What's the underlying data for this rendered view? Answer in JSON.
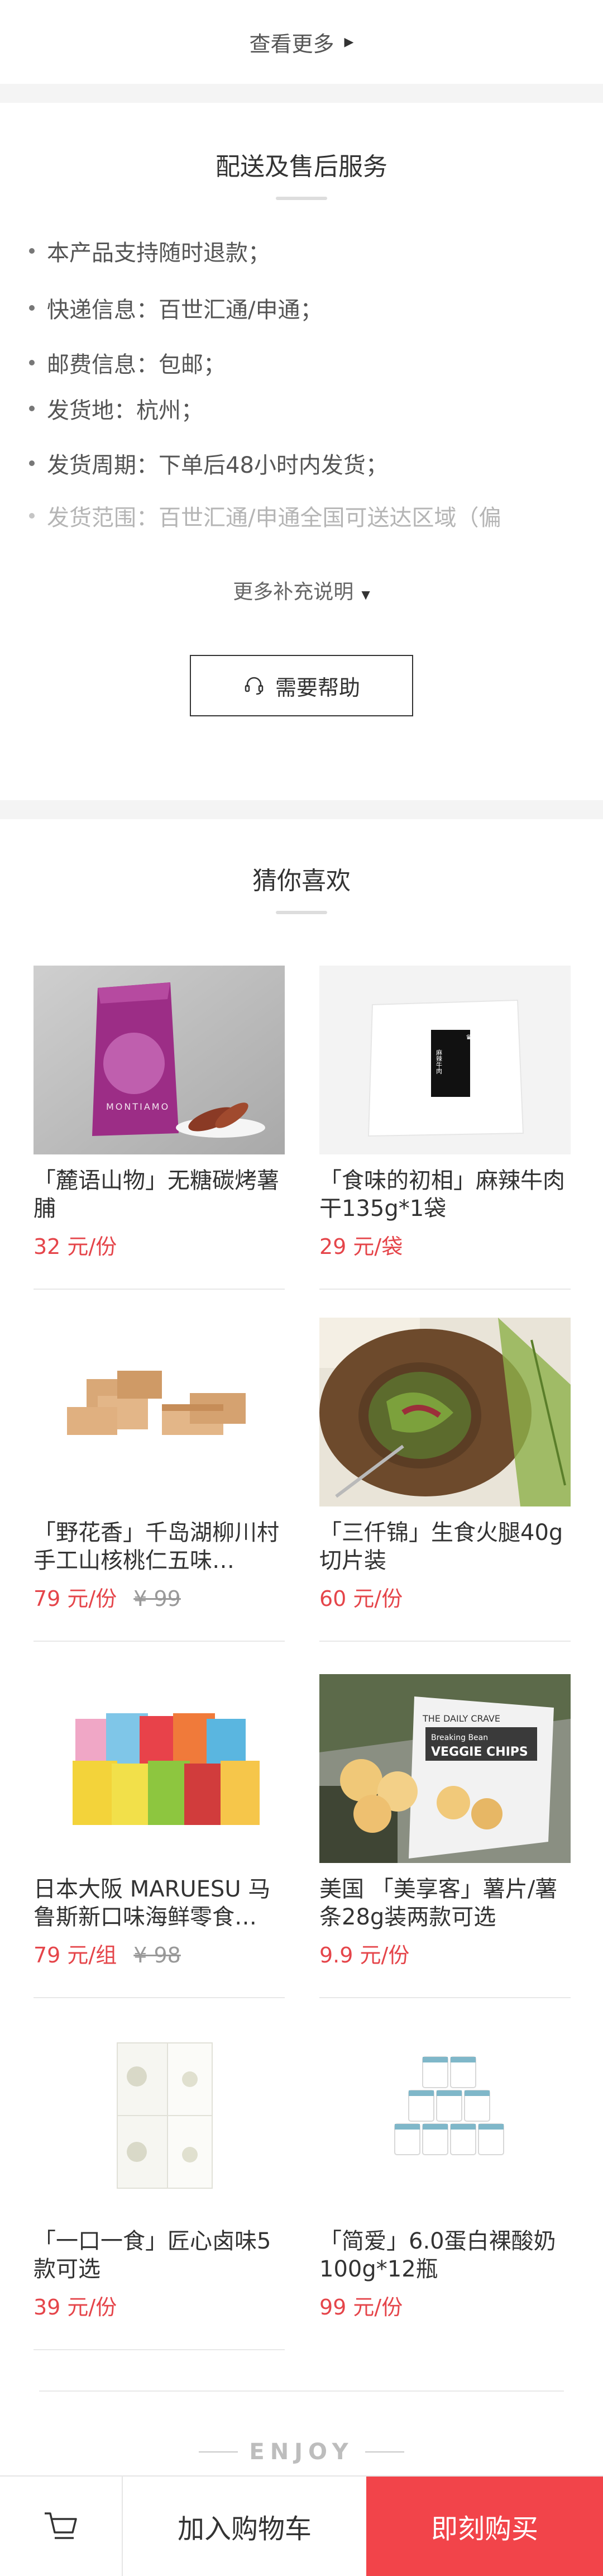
{
  "see_more": {
    "label": "查看更多"
  },
  "service": {
    "title": "配送及售后服务",
    "items": [
      "本产品支持随时退款；",
      "快递信息：百世汇通/申通；",
      "邮费信息：包邮；",
      "发货地：杭州；",
      "发货周期：下单后48小时内发货；",
      "发货范围：百世汇通/申通全国可送达区域（偏"
    ],
    "more_label": "更多补充说明",
    "help_label": "需要帮助"
  },
  "recommend": {
    "title": "猜你喜欢",
    "products": [
      {
        "name": "「麓语山物」无糖碳烤薯脯",
        "price": "32 元/份",
        "original_price": ""
      },
      {
        "name": "「食味的初相」麻辣牛肉干135g*1袋",
        "price": "29 元/袋",
        "original_price": ""
      },
      {
        "name": "「野花香」千岛湖柳川村手工山核桃仁五味…",
        "price": "79 元/份",
        "original_price": "¥ 99"
      },
      {
        "name": "「三仟锦」生食火腿40g切片装",
        "price": "60 元/份",
        "original_price": ""
      },
      {
        "name": "日本大阪 MARUESU 马鲁斯新口味海鲜零食…",
        "price": "79 元/组",
        "original_price": "¥ 98"
      },
      {
        "name": "美国 「美享客」薯片/薯条28g装两款可选",
        "price": "9.9 元/份",
        "original_price": ""
      },
      {
        "name": "「一口一食」匠心卤味5款可选",
        "price": "39 元/份",
        "original_price": ""
      },
      {
        "name": "「简爱」6.0蛋白裸酸奶100g*12瓶",
        "price": "99 元/份",
        "original_price": ""
      }
    ],
    "image_text": {
      "bag_brand": "MONTIAMO",
      "label_tag": "麻辣牛肉",
      "chips_brand": "THE DAILY CRAVE",
      "chips_name": "Breaking Bean",
      "chips_sub": "VEGGIE CHIPS"
    }
  },
  "footer": {
    "enjoy": "ENJOY",
    "add_cart_label": "加入购物车",
    "buy_now_label": "即刻购买"
  },
  "colors": {
    "accent_red": "#f2444a",
    "price_red": "#e5454a",
    "gap_gray": "#f4f4f4"
  },
  "icons": {
    "see_more": "triangle-right-icon",
    "more_explain": "triangle-down-icon",
    "help": "headset-icon",
    "cart": "cart-icon"
  }
}
